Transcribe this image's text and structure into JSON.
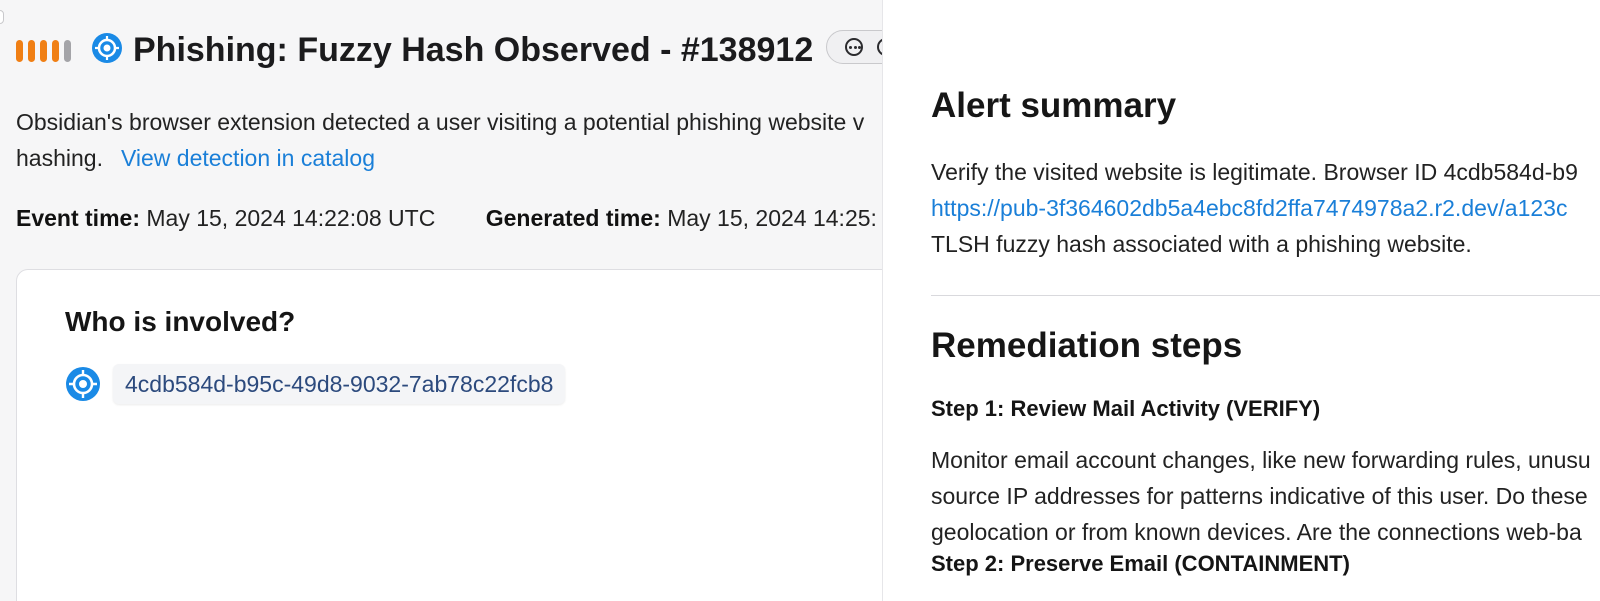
{
  "alert": {
    "title": "Phishing: Fuzzy Hash Observed - #138912",
    "severity": {
      "level": 4,
      "max": 5,
      "active_color": "#f07f14",
      "inactive_color": "#a4a4a8"
    },
    "source_icon": "obsidian-logo-icon",
    "description": "Obsidian's browser extension detected a user visiting a potential phishing website v",
    "description_line2": "hashing.",
    "catalog_link": "View detection in catalog",
    "event_time_label": "Event time:",
    "event_time_value": "May 15, 2024 14:22:08 UTC",
    "generated_time_label": "Generated time:",
    "generated_time_value": "May 15, 2024 14:25:"
  },
  "involved": {
    "heading": "Who is involved?",
    "entity_id": "4cdb584d-b95c-49d8-9032-7ab78c22fcb8"
  },
  "summary": {
    "heading": "Alert summary",
    "line1": "Verify the visited website is legitimate. Browser ID 4cdb584d-b9",
    "link": "https://pub-3f364602db5a4ebc8fd2ffa7474978a2.r2.dev/a123c",
    "line3": "TLSH fuzzy hash associated with a phishing website."
  },
  "remediation": {
    "heading": "Remediation steps",
    "step1_title": "Step 1: Review Mail Activity (VERIFY)",
    "step1_lines": [
      "Monitor email account changes, like new forwarding rules, unusu",
      "source IP addresses for patterns indicative of this user. Do these",
      "geolocation or from known devices. Are the connections web-ba"
    ],
    "step2_title": "Step 2: Preserve Email (CONTAINMENT)"
  },
  "colors": {
    "link": "#1a7fd8",
    "brand_blue": "#1a8ae6",
    "chip_text": "#2c4a7d"
  }
}
